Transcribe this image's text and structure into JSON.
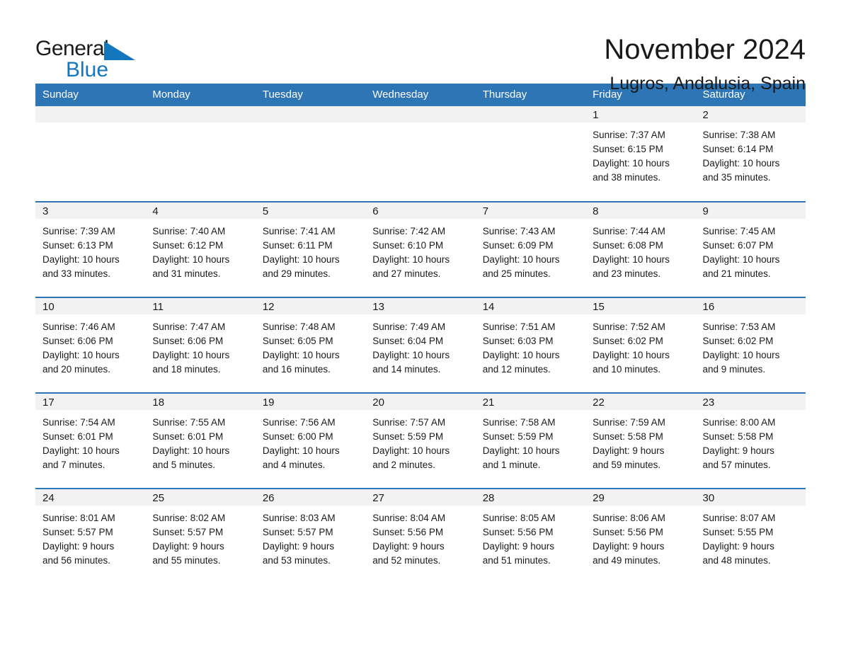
{
  "logo": {
    "word1": "General",
    "word2": "Blue",
    "triangle_color": "#1476bc",
    "icon": "triangle-icon"
  },
  "header": {
    "month_title": "November 2024",
    "location": "Lugros, Andalusia, Spain"
  },
  "colors": {
    "header_blue": "#2e75b6",
    "logo_blue": "#1476bc",
    "daynum_band": "#f2f2f2",
    "text": "#1a1a1a",
    "page_background": "#ffffff"
  },
  "weekday_headers": [
    "Sunday",
    "Monday",
    "Tuesday",
    "Wednesday",
    "Thursday",
    "Friday",
    "Saturday"
  ],
  "weeks": [
    [
      {
        "day": "",
        "empty": true,
        "sunrise": "",
        "sunset": "",
        "daylight_line1": "",
        "daylight_line2": ""
      },
      {
        "day": "",
        "empty": true,
        "sunrise": "",
        "sunset": "",
        "daylight_line1": "",
        "daylight_line2": ""
      },
      {
        "day": "",
        "empty": true,
        "sunrise": "",
        "sunset": "",
        "daylight_line1": "",
        "daylight_line2": ""
      },
      {
        "day": "",
        "empty": true,
        "sunrise": "",
        "sunset": "",
        "daylight_line1": "",
        "daylight_line2": ""
      },
      {
        "day": "",
        "empty": true,
        "sunrise": "",
        "sunset": "",
        "daylight_line1": "",
        "daylight_line2": ""
      },
      {
        "day": "1",
        "empty": false,
        "sunrise": "Sunrise: 7:37 AM",
        "sunset": "Sunset: 6:15 PM",
        "daylight_line1": "Daylight: 10 hours",
        "daylight_line2": "and 38 minutes."
      },
      {
        "day": "2",
        "empty": false,
        "sunrise": "Sunrise: 7:38 AM",
        "sunset": "Sunset: 6:14 PM",
        "daylight_line1": "Daylight: 10 hours",
        "daylight_line2": "and 35 minutes."
      }
    ],
    [
      {
        "day": "3",
        "empty": false,
        "sunrise": "Sunrise: 7:39 AM",
        "sunset": "Sunset: 6:13 PM",
        "daylight_line1": "Daylight: 10 hours",
        "daylight_line2": "and 33 minutes."
      },
      {
        "day": "4",
        "empty": false,
        "sunrise": "Sunrise: 7:40 AM",
        "sunset": "Sunset: 6:12 PM",
        "daylight_line1": "Daylight: 10 hours",
        "daylight_line2": "and 31 minutes."
      },
      {
        "day": "5",
        "empty": false,
        "sunrise": "Sunrise: 7:41 AM",
        "sunset": "Sunset: 6:11 PM",
        "daylight_line1": "Daylight: 10 hours",
        "daylight_line2": "and 29 minutes."
      },
      {
        "day": "6",
        "empty": false,
        "sunrise": "Sunrise: 7:42 AM",
        "sunset": "Sunset: 6:10 PM",
        "daylight_line1": "Daylight: 10 hours",
        "daylight_line2": "and 27 minutes."
      },
      {
        "day": "7",
        "empty": false,
        "sunrise": "Sunrise: 7:43 AM",
        "sunset": "Sunset: 6:09 PM",
        "daylight_line1": "Daylight: 10 hours",
        "daylight_line2": "and 25 minutes."
      },
      {
        "day": "8",
        "empty": false,
        "sunrise": "Sunrise: 7:44 AM",
        "sunset": "Sunset: 6:08 PM",
        "daylight_line1": "Daylight: 10 hours",
        "daylight_line2": "and 23 minutes."
      },
      {
        "day": "9",
        "empty": false,
        "sunrise": "Sunrise: 7:45 AM",
        "sunset": "Sunset: 6:07 PM",
        "daylight_line1": "Daylight: 10 hours",
        "daylight_line2": "and 21 minutes."
      }
    ],
    [
      {
        "day": "10",
        "empty": false,
        "sunrise": "Sunrise: 7:46 AM",
        "sunset": "Sunset: 6:06 PM",
        "daylight_line1": "Daylight: 10 hours",
        "daylight_line2": "and 20 minutes."
      },
      {
        "day": "11",
        "empty": false,
        "sunrise": "Sunrise: 7:47 AM",
        "sunset": "Sunset: 6:06 PM",
        "daylight_line1": "Daylight: 10 hours",
        "daylight_line2": "and 18 minutes."
      },
      {
        "day": "12",
        "empty": false,
        "sunrise": "Sunrise: 7:48 AM",
        "sunset": "Sunset: 6:05 PM",
        "daylight_line1": "Daylight: 10 hours",
        "daylight_line2": "and 16 minutes."
      },
      {
        "day": "13",
        "empty": false,
        "sunrise": "Sunrise: 7:49 AM",
        "sunset": "Sunset: 6:04 PM",
        "daylight_line1": "Daylight: 10 hours",
        "daylight_line2": "and 14 minutes."
      },
      {
        "day": "14",
        "empty": false,
        "sunrise": "Sunrise: 7:51 AM",
        "sunset": "Sunset: 6:03 PM",
        "daylight_line1": "Daylight: 10 hours",
        "daylight_line2": "and 12 minutes."
      },
      {
        "day": "15",
        "empty": false,
        "sunrise": "Sunrise: 7:52 AM",
        "sunset": "Sunset: 6:02 PM",
        "daylight_line1": "Daylight: 10 hours",
        "daylight_line2": "and 10 minutes."
      },
      {
        "day": "16",
        "empty": false,
        "sunrise": "Sunrise: 7:53 AM",
        "sunset": "Sunset: 6:02 PM",
        "daylight_line1": "Daylight: 10 hours",
        "daylight_line2": "and 9 minutes."
      }
    ],
    [
      {
        "day": "17",
        "empty": false,
        "sunrise": "Sunrise: 7:54 AM",
        "sunset": "Sunset: 6:01 PM",
        "daylight_line1": "Daylight: 10 hours",
        "daylight_line2": "and 7 minutes."
      },
      {
        "day": "18",
        "empty": false,
        "sunrise": "Sunrise: 7:55 AM",
        "sunset": "Sunset: 6:01 PM",
        "daylight_line1": "Daylight: 10 hours",
        "daylight_line2": "and 5 minutes."
      },
      {
        "day": "19",
        "empty": false,
        "sunrise": "Sunrise: 7:56 AM",
        "sunset": "Sunset: 6:00 PM",
        "daylight_line1": "Daylight: 10 hours",
        "daylight_line2": "and 4 minutes."
      },
      {
        "day": "20",
        "empty": false,
        "sunrise": "Sunrise: 7:57 AM",
        "sunset": "Sunset: 5:59 PM",
        "daylight_line1": "Daylight: 10 hours",
        "daylight_line2": "and 2 minutes."
      },
      {
        "day": "21",
        "empty": false,
        "sunrise": "Sunrise: 7:58 AM",
        "sunset": "Sunset: 5:59 PM",
        "daylight_line1": "Daylight: 10 hours",
        "daylight_line2": "and 1 minute."
      },
      {
        "day": "22",
        "empty": false,
        "sunrise": "Sunrise: 7:59 AM",
        "sunset": "Sunset: 5:58 PM",
        "daylight_line1": "Daylight: 9 hours",
        "daylight_line2": "and 59 minutes."
      },
      {
        "day": "23",
        "empty": false,
        "sunrise": "Sunrise: 8:00 AM",
        "sunset": "Sunset: 5:58 PM",
        "daylight_line1": "Daylight: 9 hours",
        "daylight_line2": "and 57 minutes."
      }
    ],
    [
      {
        "day": "24",
        "empty": false,
        "sunrise": "Sunrise: 8:01 AM",
        "sunset": "Sunset: 5:57 PM",
        "daylight_line1": "Daylight: 9 hours",
        "daylight_line2": "and 56 minutes."
      },
      {
        "day": "25",
        "empty": false,
        "sunrise": "Sunrise: 8:02 AM",
        "sunset": "Sunset: 5:57 PM",
        "daylight_line1": "Daylight: 9 hours",
        "daylight_line2": "and 55 minutes."
      },
      {
        "day": "26",
        "empty": false,
        "sunrise": "Sunrise: 8:03 AM",
        "sunset": "Sunset: 5:57 PM",
        "daylight_line1": "Daylight: 9 hours",
        "daylight_line2": "and 53 minutes."
      },
      {
        "day": "27",
        "empty": false,
        "sunrise": "Sunrise: 8:04 AM",
        "sunset": "Sunset: 5:56 PM",
        "daylight_line1": "Daylight: 9 hours",
        "daylight_line2": "and 52 minutes."
      },
      {
        "day": "28",
        "empty": false,
        "sunrise": "Sunrise: 8:05 AM",
        "sunset": "Sunset: 5:56 PM",
        "daylight_line1": "Daylight: 9 hours",
        "daylight_line2": "and 51 minutes."
      },
      {
        "day": "29",
        "empty": false,
        "sunrise": "Sunrise: 8:06 AM",
        "sunset": "Sunset: 5:56 PM",
        "daylight_line1": "Daylight: 9 hours",
        "daylight_line2": "and 49 minutes."
      },
      {
        "day": "30",
        "empty": false,
        "sunrise": "Sunrise: 8:07 AM",
        "sunset": "Sunset: 5:55 PM",
        "daylight_line1": "Daylight: 9 hours",
        "daylight_line2": "and 48 minutes."
      }
    ]
  ]
}
